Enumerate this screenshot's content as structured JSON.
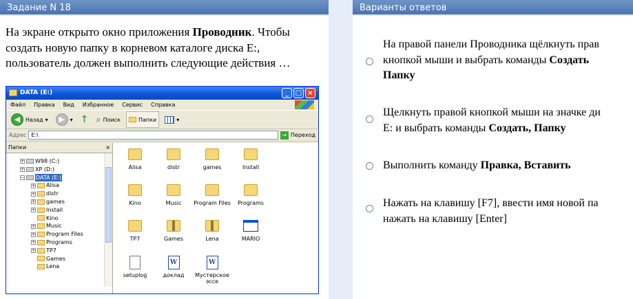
{
  "left_panel": {
    "header": "Задание N 18"
  },
  "right_panel": {
    "header": "Варианты ответов"
  },
  "question": {
    "part1": "На экране открыто окно приложения ",
    "bold": "Проводник",
    "part2": ". Чтобы создать новую папку в корневом каталоге диска E:, пользователь должен выполнить следующие действия …"
  },
  "explorer": {
    "title": "DATA (E:)",
    "menu": [
      "Файл",
      "Правка",
      "Вид",
      "Избранное",
      "Сервис",
      "Справка"
    ],
    "toolbar": {
      "back": "Назад",
      "search": "Поиск",
      "folders": "Папки"
    },
    "address_label": "Адрес",
    "address_value": "E:\\",
    "go_label": "Переход",
    "tree_header": "Папки",
    "tree": [
      {
        "label": "W98 (C:)",
        "level": 1,
        "type": "drive",
        "pm": "+"
      },
      {
        "label": "XP (D:)",
        "level": 1,
        "type": "drive",
        "pm": "+"
      },
      {
        "label": "DATA (E:)",
        "level": 1,
        "type": "drive",
        "pm": "−",
        "selected": true
      },
      {
        "label": "Alisa",
        "level": 2,
        "type": "folder",
        "pm": "+"
      },
      {
        "label": "distr",
        "level": 2,
        "type": "folder",
        "pm": "+"
      },
      {
        "label": "games",
        "level": 2,
        "type": "folder",
        "pm": "+"
      },
      {
        "label": "Install",
        "level": 2,
        "type": "folder",
        "pm": "+"
      },
      {
        "label": "Kino",
        "level": 2,
        "type": "folder",
        "pm": ""
      },
      {
        "label": "Music",
        "level": 2,
        "type": "folder",
        "pm": "+"
      },
      {
        "label": "Program Files",
        "level": 2,
        "type": "folder",
        "pm": "+"
      },
      {
        "label": "Programs",
        "level": 2,
        "type": "folder",
        "pm": "+"
      },
      {
        "label": "TP7",
        "level": 2,
        "type": "folder",
        "pm": "+"
      },
      {
        "label": "Games",
        "level": 2,
        "type": "folder",
        "pm": ""
      },
      {
        "label": "Lena",
        "level": 2,
        "type": "folder",
        "pm": ""
      }
    ],
    "files": [
      {
        "label": "Alisa",
        "icon": "folder"
      },
      {
        "label": "distr",
        "icon": "folder"
      },
      {
        "label": "games",
        "icon": "folder"
      },
      {
        "label": "Install",
        "icon": "folder"
      },
      {
        "label": "Kino",
        "icon": "folder"
      },
      {
        "label": "Music",
        "icon": "folder"
      },
      {
        "label": "Program Files",
        "icon": "folder"
      },
      {
        "label": "Programs",
        "icon": "folder"
      },
      {
        "label": "TP7",
        "icon": "folder"
      },
      {
        "label": "Games",
        "icon": "zip-folder"
      },
      {
        "label": "Lena",
        "icon": "zip-folder"
      },
      {
        "label": "MARIO",
        "icon": "exe"
      },
      {
        "label": "setuplog",
        "icon": "text-doc"
      },
      {
        "label": "доклад",
        "icon": "word-doc"
      },
      {
        "label": "Мустерское эссе",
        "icon": "word-doc"
      }
    ]
  },
  "answers": [
    {
      "lines": [
        [
          "На правой панели Проводника щёлкнуть прав"
        ],
        [
          "кнопкой мыши и выбрать команды ",
          "Создать"
        ],
        [
          "",
          "Папку"
        ]
      ]
    },
    {
      "lines": [
        [
          "Щелкнуть правой кнопкой мыши на значке ди"
        ],
        [
          "E: и выбрать команды ",
          "Создать, Папку"
        ]
      ]
    },
    {
      "lines": [
        [
          "Выполнить команду ",
          "Правка, Вставить"
        ]
      ]
    },
    {
      "lines": [
        [
          "Нажать на клавишу [F7], ввести имя новой па"
        ],
        [
          "нажать на клавишу [Enter]"
        ]
      ]
    }
  ]
}
